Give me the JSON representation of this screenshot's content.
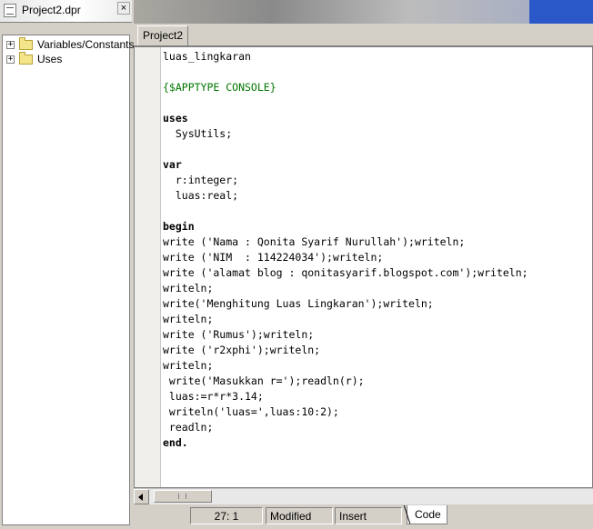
{
  "explorer": {
    "title": "Project2.dpr",
    "close_label": "×",
    "items": [
      {
        "expander": "+",
        "label": "Variables/Constants"
      },
      {
        "expander": "+",
        "label": "Uses"
      }
    ]
  },
  "editor": {
    "tab_label": "Project2",
    "lines": [
      {
        "text": "luas_lingkaran",
        "dot": false,
        "style": ""
      },
      {
        "text": "",
        "dot": false,
        "style": ""
      },
      {
        "text": "{$APPTYPE CONSOLE}",
        "dot": false,
        "style": "dir"
      },
      {
        "text": "",
        "dot": false,
        "style": ""
      },
      {
        "text": "uses",
        "dot": false,
        "style": "kw"
      },
      {
        "text": "  SysUtils;",
        "dot": false,
        "style": ""
      },
      {
        "text": "",
        "dot": false,
        "style": ""
      },
      {
        "text": "var",
        "dot": false,
        "style": "kw"
      },
      {
        "text": "  r:integer;",
        "dot": false,
        "style": ""
      },
      {
        "text": "  luas:real;",
        "dot": false,
        "style": ""
      },
      {
        "text": "",
        "dot": false,
        "style": ""
      },
      {
        "text": "begin",
        "dot": true,
        "style": "kw"
      },
      {
        "text": "write ('Nama : Qonita Syarif Nurullah');writeln;",
        "dot": true,
        "style": ""
      },
      {
        "text": "write ('NIM  : 114224034');writeln;",
        "dot": true,
        "style": ""
      },
      {
        "text": "write ('alamat blog : qonitasyarif.blogspot.com');writeln;",
        "dot": true,
        "style": ""
      },
      {
        "text": "writeln;",
        "dot": true,
        "style": ""
      },
      {
        "text": "write('Menghitung Luas Lingkaran');writeln;",
        "dot": true,
        "style": ""
      },
      {
        "text": "writeln;",
        "dot": true,
        "style": ""
      },
      {
        "text": "write ('Rumus');writeln;",
        "dot": true,
        "style": ""
      },
      {
        "text": "write ('r2xphi');writeln;",
        "dot": true,
        "style": ""
      },
      {
        "text": "writeln;",
        "dot": true,
        "style": ""
      },
      {
        "text": " write('Masukkan r=');readln(r);",
        "dot": true,
        "style": ""
      },
      {
        "text": " luas:=r*r*3.14;",
        "dot": true,
        "style": ""
      },
      {
        "text": " writeln('luas=',luas:10:2);",
        "dot": true,
        "style": ""
      },
      {
        "text": " readln;",
        "dot": true,
        "style": ""
      },
      {
        "text": "end.",
        "dot": true,
        "style": "kw"
      }
    ]
  },
  "status": {
    "position": "27:  1",
    "modified": "Modified",
    "mode": "Insert",
    "code_tab": "Code"
  },
  "icons": {
    "file": "file-icon",
    "folder": "folder-icon",
    "close": "close-icon",
    "scroll_left": "scroll-left-icon"
  }
}
